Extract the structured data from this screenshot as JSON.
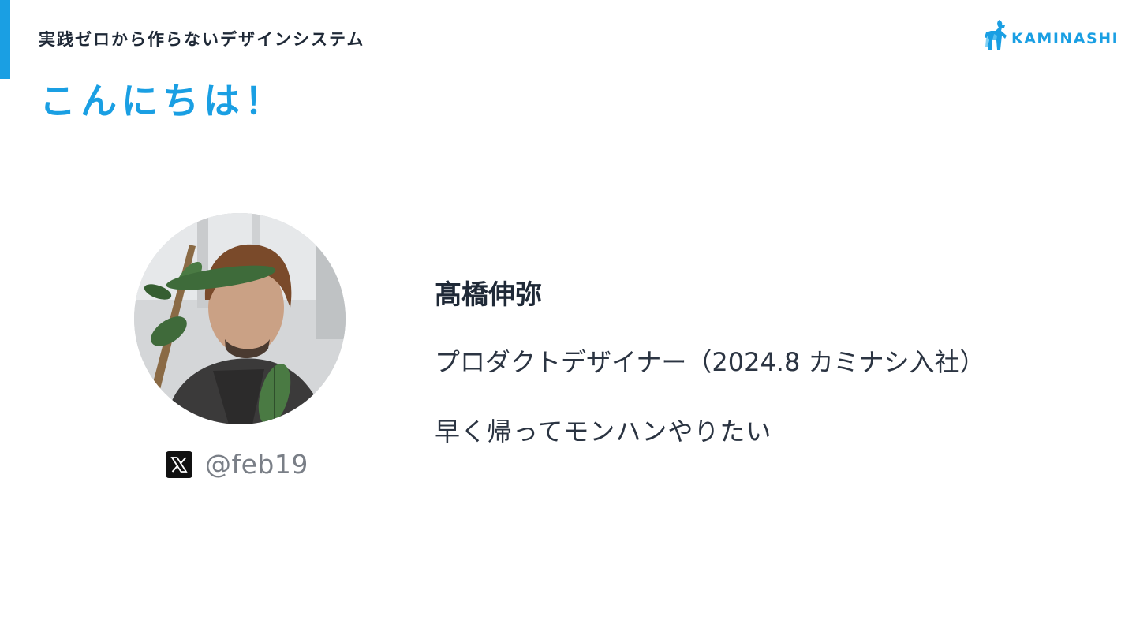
{
  "header": {
    "deck_title": "実践ゼロから作らないデザインシステム",
    "slide_heading": "こんにちは！"
  },
  "logo": {
    "text": "KAMINASHI",
    "icon": "goat-logo-icon"
  },
  "profile": {
    "name": "髙橋伸弥",
    "role": "プロダクトデザイナー（2024.8 カミナシ入社）",
    "motto": "早く帰ってモンハンやりたい",
    "social_icon": "x-logo-icon",
    "handle": "@feb19"
  },
  "colors": {
    "accent": "#1a9fe3",
    "heading_text": "#1f2937",
    "body_text": "#2b3442",
    "handle_text": "#7a7f87"
  }
}
